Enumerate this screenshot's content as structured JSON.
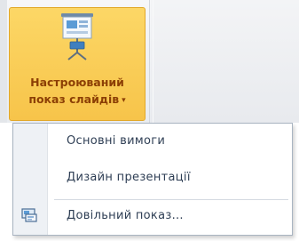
{
  "ribbon": {
    "custom_slideshow_button": {
      "icon": "projector-screen-icon",
      "label_line1": "Настроюваний",
      "label_line2": "показ слайдів",
      "dropdown_glyph": "▾"
    }
  },
  "menu": {
    "items": [
      {
        "label": "Основні вимоги",
        "icon": null
      },
      {
        "label": "Дизайн презентації",
        "icon": null
      },
      {
        "label": "Довільний показ...",
        "icon": "custom-show-icon"
      }
    ]
  }
}
